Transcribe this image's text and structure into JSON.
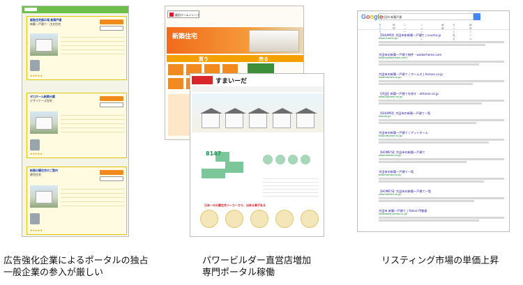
{
  "captions": {
    "left": [
      "広告強化企業によるポータルの独占",
      "一般企業の参入が厳しい"
    ],
    "center": [
      "パワービルダー直営店増加",
      "専門ポータル稼働"
    ],
    "right": [
      "リスティング市場の単価上昇"
    ]
  },
  "panel_portal": {
    "cards": [
      {
        "title": "飯能住宅展示場 新築戸建",
        "sub": "新築一戸建て・注文住宅"
      },
      {
        "title": "ゼロホーム新築分譲",
        "sub": "デザイナーズ住宅"
      },
      {
        "title": "新築分譲住宅のご案内",
        "sub": "建売住宅"
      }
    ],
    "button_label": "資料請求する",
    "stars": "★★★★★"
  },
  "panel_builder": {
    "logo_text": "飯田ホームトレーセンター",
    "hero_copy": "新築住宅",
    "band_buy": "買う",
    "band_sell": "売る"
  },
  "panel_sumai": {
    "site_name": "すまいーだ",
    "count": "8147",
    "footer_message": "日本一の分譲住宅メーカーから、出来る事がある"
  },
  "panel_google": {
    "logo": "Google",
    "query": "大田市 新築戸建",
    "tabs": [
      "すべて",
      "地図",
      "ニュース",
      "ショッピング",
      "画像",
      "もっと見る",
      "検索ツール"
    ],
    "results": [
      {
        "title": "【SUUMO】大田市の新築一戸建て | suumo.jp",
        "url": "www.suumo.jp/"
      },
      {
        "title": "大田市の新築一戸建て物件 - walkerhome.com",
        "url": "www.walkerhome.com/"
      },
      {
        "title": "大田市の新築一戸建て | ホームズ | homes.co.jp",
        "url": "www.homes.co.jp/"
      },
      {
        "title": "【大田】新築一戸建てを探す - athome.co.jp",
        "url": "www.athome.co.jp/"
      },
      {
        "title": "【SUUMO】大田市の新築一戸建て一覧",
        "url": "suumo.jp/"
      },
      {
        "title": "大田市の新築一戸建て | アットホーム",
        "url": "www.athome.co.jp/"
      },
      {
        "title": "【HOME'S】大田市の新築一戸建て",
        "url": "www.homes.co.jp/"
      },
      {
        "title": "大田市の新築一戸建て一覧",
        "url": "www.homes.co.jp/"
      },
      {
        "title": "【HOME'S】大田市の新築一戸建て一覧",
        "url": "www.homes.co.jp/"
      },
      {
        "title": "大田市 新築一戸建て | Yahoo!不動産",
        "url": "realestate.yahoo.co.jp/"
      }
    ]
  }
}
